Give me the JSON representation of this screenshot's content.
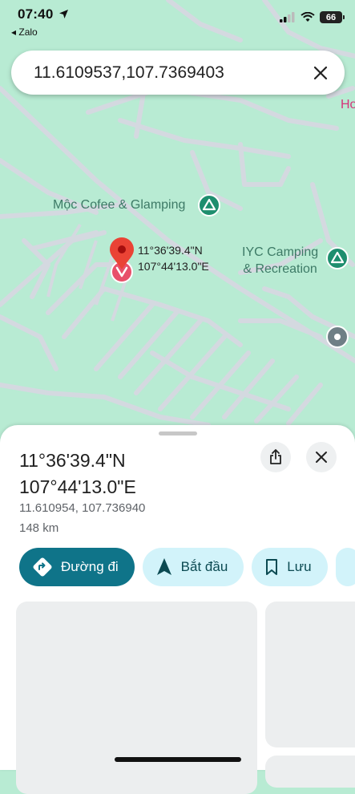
{
  "status_bar": {
    "time": "07:40",
    "back_app": "◂ Zalo",
    "battery": "66"
  },
  "search": {
    "query": "11.6109537,107.7369403"
  },
  "map": {
    "places": [
      {
        "name": "Mộc Cofee & Glamping"
      },
      {
        "name_line1": "IYC Camping",
        "name_line2": "& Recreation"
      }
    ],
    "edge_label": "Ho",
    "pin_label_lat": "11°36'39.4\"N",
    "pin_label_lng": "107°44'13.0\"E",
    "colors": {
      "land": "#b8ebd3",
      "road": "#d4d9e0",
      "pin": "#ea4335",
      "poi": "#1e8e6e"
    }
  },
  "place": {
    "title_lat": "11°36'39.4\"N",
    "title_lng": "107°44'13.0\"E",
    "decimal": "11.610954, 107.736940",
    "distance": "148 km"
  },
  "actions": {
    "directions": "Đường đi",
    "start": "Bắt đầu",
    "save": "Lưu"
  },
  "colors": {
    "primary_button": "#0f7489",
    "chip": "#d2f3fa"
  }
}
